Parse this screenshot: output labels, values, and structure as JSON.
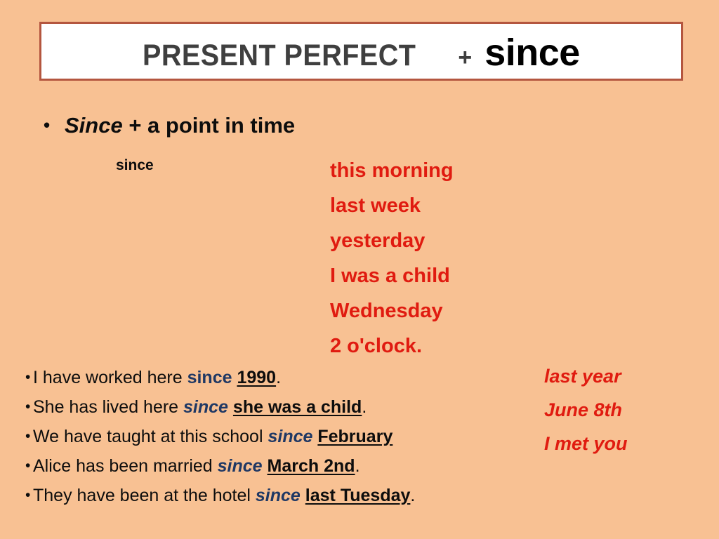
{
  "colors": {
    "background": "#f8c193",
    "banner_bg": "#ffffff",
    "banner_border": "#b4563f",
    "title_gray": "#3f3f3f",
    "title_black": "#000000",
    "accent_red": "#e01b10",
    "keyword_navy": "#1f3864",
    "body_black": "#0d0d0d"
  },
  "title": {
    "main": "PRESENT PERFECT",
    "plus": "+",
    "keyword": "since"
  },
  "lead": {
    "bullet_glyph": "•",
    "keyword": "Since",
    "rest": " + a point in time"
  },
  "since_label": "since",
  "time_expressions": [
    "this morning",
    "last week",
    "yesterday",
    "I was a child",
    "Wednesday",
    "2 o'clock."
  ],
  "examples": {
    "bullet_glyph": "•",
    "items": [
      {
        "before": "I have worked here ",
        "keyword": "since",
        "keyword_italic": false,
        "underlined": "1990",
        "after": "."
      },
      {
        "before": "She has lived here ",
        "keyword": "since",
        "keyword_italic": true,
        "underlined": "she was a child",
        "after": "."
      },
      {
        "before": "We have taught at this school ",
        "keyword": "since",
        "keyword_italic": true,
        "underlined": "February",
        "after": ""
      },
      {
        "before": "Alice has been married ",
        "keyword": "since",
        "keyword_italic": true,
        "underlined": "March 2nd",
        "after": "."
      },
      {
        "before": "They have been at the hotel ",
        "keyword": "since",
        "keyword_italic": true,
        "underlined": "last Tuesday",
        "after": "."
      }
    ]
  },
  "right_column": [
    "last year",
    "June 8th",
    "I met you"
  ]
}
